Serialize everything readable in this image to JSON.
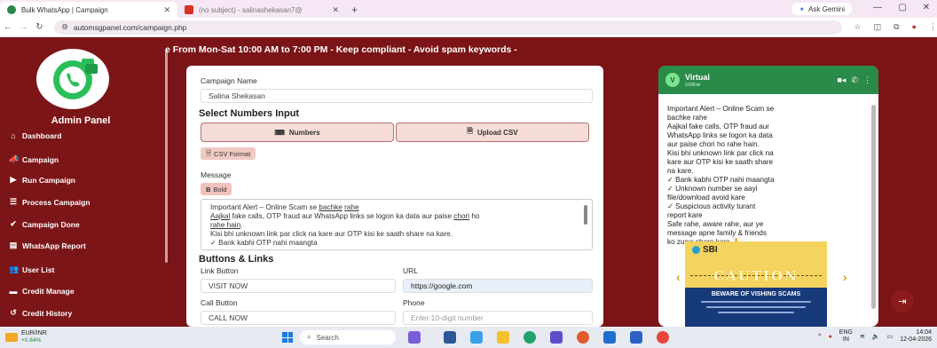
{
  "browser": {
    "tabs": [
      {
        "title": "Bulk WhatsApp | Campaign",
        "active": true
      },
      {
        "title": "(no subject) - salinashekasan7@",
        "active": false
      }
    ],
    "new_tab": "+",
    "ask_gemini": "Ask Gemini",
    "url": "automsgpanel.com/campaign.php"
  },
  "sidebar": {
    "title": "Admin Panel",
    "items": [
      {
        "label": "Dashboard",
        "icon": "home-icon"
      },
      {
        "label": "Campaign",
        "icon": "megaphone-icon"
      },
      {
        "label": "Run Campaign",
        "icon": "play-icon"
      },
      {
        "label": "Process Campaign",
        "icon": "list-icon"
      },
      {
        "label": "Campaign Done",
        "icon": "check-icon"
      },
      {
        "label": "WhatsApp Report",
        "icon": "report-icon"
      },
      {
        "label": "User List",
        "icon": "users-icon"
      },
      {
        "label": "Credit Manage",
        "icon": "card-icon"
      },
      {
        "label": "Credit History",
        "icon": "history-icon"
      }
    ]
  },
  "banner": "e From Mon-Sat 10:00 AM to 7:00 PM - Keep compliant - Avoid spam keywords -",
  "form": {
    "campaign_name_label": "Campaign Name",
    "campaign_name_value": "Salina Shekasan",
    "select_numbers_heading": "Select Numbers Input",
    "numbers_button": "Numbers",
    "upload_csv_button": "Upload CSV",
    "csv_format_button": "CSV Format",
    "message_label": "Message",
    "bold_button": "Bold",
    "message_lines": [
      [
        "Important Alert – Online Scam se ",
        "bachke",
        " ",
        "rahe"
      ],
      [
        "Aajkal",
        " fake calls, OTP fraud aur WhatsApp links se logon ka data aur paise ",
        "chori",
        " ho"
      ],
      [
        "rahe hain",
        "."
      ],
      [
        "Kisi bhi unknown link par click na kare aur OTP kisi ke saath share na kare."
      ],
      [
        "✓ Bank kabhi OTP nahi maangta"
      ]
    ],
    "buttons_links_heading": "Buttons & Links",
    "link_button_label": "Link Button",
    "link_button_value": "VISIT NOW",
    "url_label": "URL",
    "url_value": "https://google.com",
    "call_button_label": "Call Button",
    "call_button_value": "CALL NOW",
    "phone_label": "Phone",
    "phone_placeholder": "Enter 10-digit number"
  },
  "preview": {
    "avatar_letter": "V",
    "name": "Virtual",
    "status": "online",
    "message": [
      "Important Alert – Online Scam se",
      "bachke rahe",
      "Aajkal fake calls, OTP fraud aur",
      "WhatsApp links se logon ka data",
      "aur paise chori ho rahe hain.",
      "Kisi bhi unknown link par click na",
      "kare aur OTP kisi ke saath share",
      "na kare.",
      "✓ Bank kabhi OTP nahi maangta",
      "✓ Unknown number se aayi",
      "file/download avoid kare",
      "✓ Suspicious activity turant",
      "report kare",
      "Safe rahe, aware rahe, aur ye",
      "message apne family & friends",
      "ko zurur share kare 🙏"
    ],
    "ad": {
      "brand": "SBI",
      "headline": "CAUTION",
      "subhead": "BEWARE OF VISHING SCAMS"
    }
  },
  "taskbar": {
    "ticker_name": "EUR/INR",
    "ticker_change": "+0.84%",
    "search_placeholder": "Search",
    "lang_top": "ENG",
    "lang_bottom": "IN",
    "time": "14:04",
    "date": "12-04-2026"
  },
  "colors": {
    "brand_maroon": "#7c1518",
    "whatsapp_green": "#2a8a49",
    "button_tint": "#f5dcd7"
  }
}
